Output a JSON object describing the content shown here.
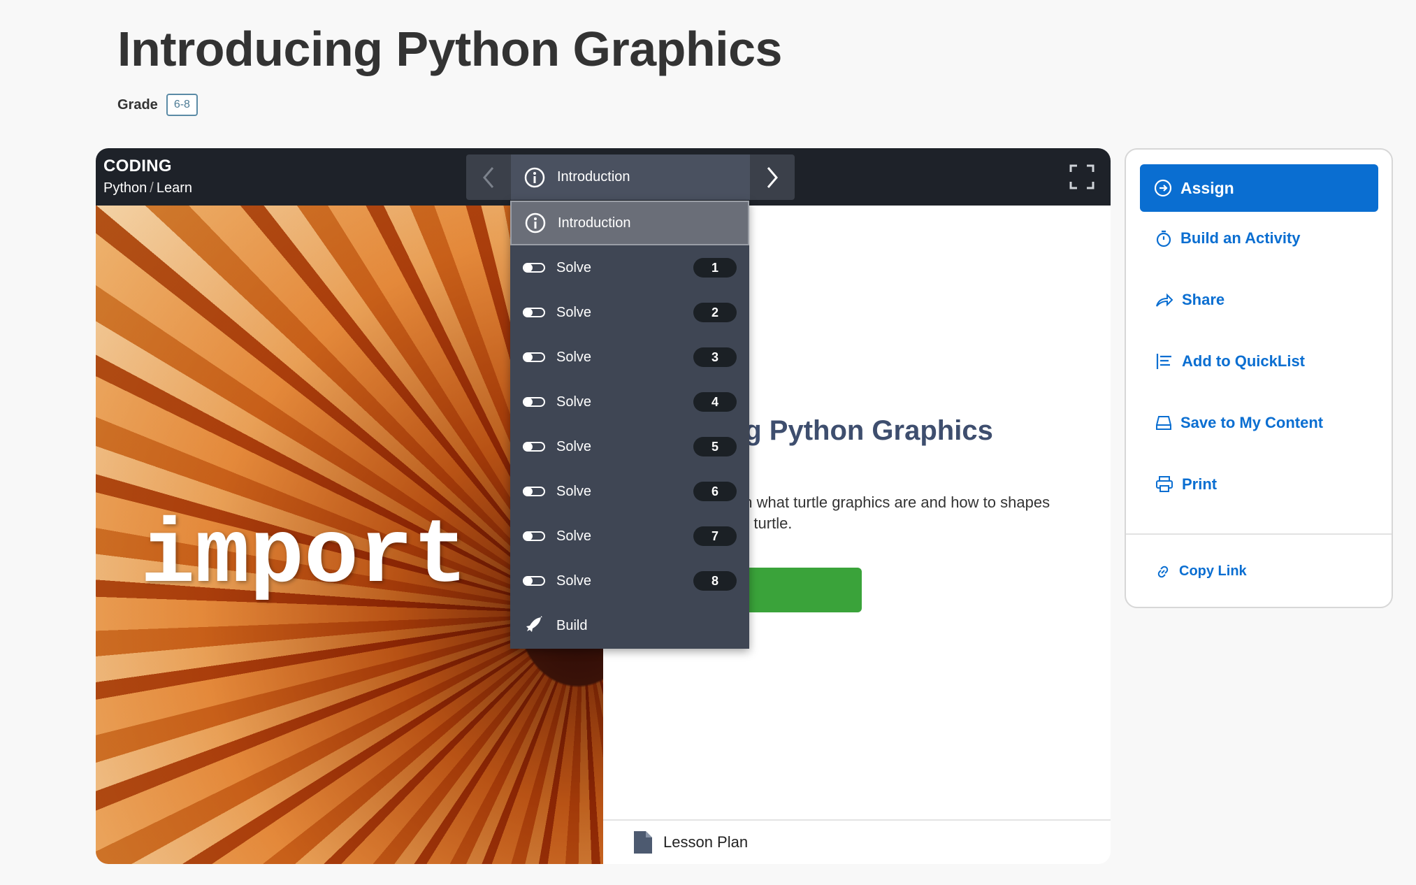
{
  "page": {
    "title": "Introducing Python Graphics",
    "grade_label": "Grade",
    "grade_value": "6-8"
  },
  "player": {
    "course_title": "CODING",
    "breadcrumb": [
      "Python",
      "Learn"
    ],
    "current_step": "Introduction",
    "hero_word": "import",
    "content_title": "ucing Python Graphics",
    "content_description": "ou'll learn what turtle graphics are and how to shapes using the turtle.",
    "lesson_plan_label": "Lesson Plan"
  },
  "dropdown": {
    "items": [
      {
        "label": "Introduction",
        "icon": "info-icon",
        "num": ""
      },
      {
        "label": "Solve",
        "icon": "toggle-icon",
        "num": "1"
      },
      {
        "label": "Solve",
        "icon": "toggle-icon",
        "num": "2"
      },
      {
        "label": "Solve",
        "icon": "toggle-icon",
        "num": "3"
      },
      {
        "label": "Solve",
        "icon": "toggle-icon",
        "num": "4"
      },
      {
        "label": "Solve",
        "icon": "toggle-icon",
        "num": "5"
      },
      {
        "label": "Solve",
        "icon": "toggle-icon",
        "num": "6"
      },
      {
        "label": "Solve",
        "icon": "toggle-icon",
        "num": "7"
      },
      {
        "label": "Solve",
        "icon": "toggle-icon",
        "num": "8"
      },
      {
        "label": "Build",
        "icon": "rocket-icon",
        "num": ""
      }
    ]
  },
  "sidebar": {
    "assign_label": "Assign",
    "build_activity_label": "Build an Activity",
    "share_label": "Share",
    "quicklist_label": "Add to QuickList",
    "save_label": "Save to My Content",
    "print_label": "Print",
    "copy_link_label": "Copy Link"
  },
  "colors": {
    "accent": "#0a6ed1",
    "topbar": "#1e2229",
    "dropdown_bg": "#3f4654",
    "start_green": "#3aa33a"
  }
}
